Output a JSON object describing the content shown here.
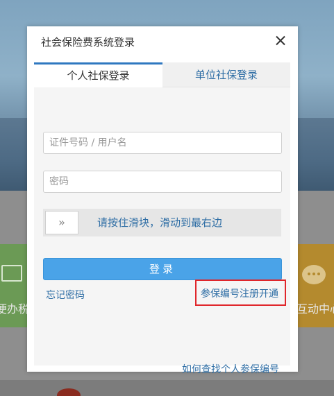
{
  "background": {
    "left_tile_label": "便办税",
    "right_tile_label": "互动中心"
  },
  "modal": {
    "title": "社会保险费系统登录",
    "tabs": [
      {
        "label": "个人社保登录",
        "active": true
      },
      {
        "label": "单位社保登录",
        "active": false
      }
    ],
    "username_placeholder": "证件号码 / 用户名",
    "password_placeholder": "密码",
    "slider": {
      "handle_glyph": "»",
      "hint": "请按住滑块，滑动到最右边"
    },
    "login_label": "登录",
    "forgot_label": "忘记密码",
    "register_label": "参保编号注册开通",
    "find_number_label": "如何查找个人参保编号"
  },
  "colors": {
    "accent": "#2f78c0",
    "link": "#2f6ea5",
    "button": "#4aa3e8",
    "highlight": "#e0262b"
  }
}
